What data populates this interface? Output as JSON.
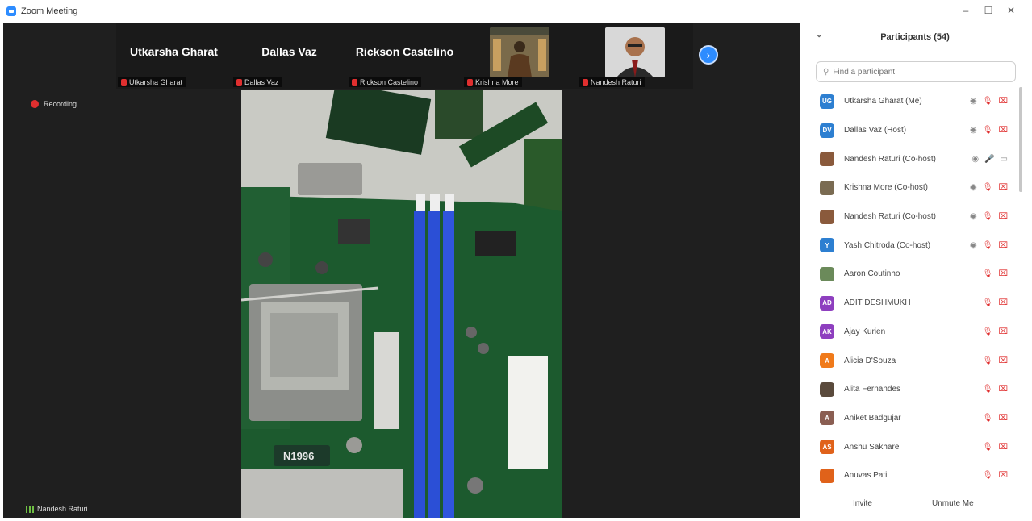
{
  "window": {
    "title": "Zoom Meeting",
    "minimize": "–",
    "maximize": "☐",
    "close": "✕"
  },
  "strip": {
    "tiles": [
      {
        "name": "Utkarsha Gharat",
        "label": "Utkarsha Gharat",
        "has_photo": false
      },
      {
        "name": "Dallas Vaz",
        "label": "Dallas Vaz",
        "has_photo": false
      },
      {
        "name": "Rickson Castelino",
        "label": "Rickson Castelino",
        "has_photo": false
      },
      {
        "name": "",
        "label": "Krishna More",
        "has_photo": true
      },
      {
        "name": "",
        "label": "Nandesh Raturi",
        "has_photo": true
      }
    ],
    "next_icon": "›"
  },
  "recording": {
    "label": "Recording"
  },
  "main_video": {
    "label": "Nandesh Raturi"
  },
  "panel": {
    "title": "Participants (54)",
    "collapse_icon": "⌄",
    "search_placeholder": "Find a participant",
    "search_icon": "⚲",
    "participants": [
      {
        "initials": "UG",
        "name": "Utkarsha Gharat (Me)",
        "color": "#2d7fd1",
        "video_icon": true,
        "mic": "off",
        "cam": "off"
      },
      {
        "initials": "DV",
        "name": "Dallas Vaz (Host)",
        "color": "#2d7fd1",
        "video_icon": true,
        "mic": "off",
        "cam": "off"
      },
      {
        "initials": "",
        "name": "Nandesh Raturi (Co-host)",
        "color": "#8a5a3c",
        "video_icon": true,
        "mic": "on",
        "cam": "on"
      },
      {
        "initials": "",
        "name": "Krishna More (Co-host)",
        "color": "#7a6b52",
        "video_icon": true,
        "mic": "off",
        "cam": "off"
      },
      {
        "initials": "",
        "name": "Nandesh Raturi (Co-host)",
        "color": "#8a5a3c",
        "video_icon": true,
        "mic": "off",
        "cam": "off"
      },
      {
        "initials": "Y",
        "name": "Yash Chitroda (Co-host)",
        "color": "#2d7fd1",
        "video_icon": true,
        "mic": "off",
        "cam": "off"
      },
      {
        "initials": "",
        "name": "Aaron Coutinho",
        "color": "#6b8a5a",
        "video_icon": false,
        "mic": "off",
        "cam": "off"
      },
      {
        "initials": "AD",
        "name": "ADIT DESHMUKH",
        "color": "#8e3fbf",
        "video_icon": false,
        "mic": "off",
        "cam": "off"
      },
      {
        "initials": "AK",
        "name": "Ajay Kurien",
        "color": "#8e3fbf",
        "video_icon": false,
        "mic": "off",
        "cam": "off"
      },
      {
        "initials": "A",
        "name": "Alicia D'Souza",
        "color": "#f07a1a",
        "video_icon": false,
        "mic": "off",
        "cam": "off"
      },
      {
        "initials": "",
        "name": "Alita Fernandes",
        "color": "#5a4a3c",
        "video_icon": false,
        "mic": "off",
        "cam": "off"
      },
      {
        "initials": "A",
        "name": "Aniket Badgujar",
        "color": "#8a5e52",
        "video_icon": false,
        "mic": "off",
        "cam": "off"
      },
      {
        "initials": "AS",
        "name": "Anshu Sakhare",
        "color": "#e0621a",
        "video_icon": false,
        "mic": "off",
        "cam": "off"
      },
      {
        "initials": "",
        "name": "Anuvas Patil",
        "color": "#e0621a",
        "video_icon": false,
        "mic": "off",
        "cam": "off"
      }
    ],
    "footer": {
      "invite": "Invite",
      "unmute": "Unmute Me"
    }
  },
  "icons": {
    "mic_off": "🎙",
    "cam_off": "⌧",
    "video": "◉",
    "mic_on": "🎤",
    "cam_on": "▭"
  }
}
